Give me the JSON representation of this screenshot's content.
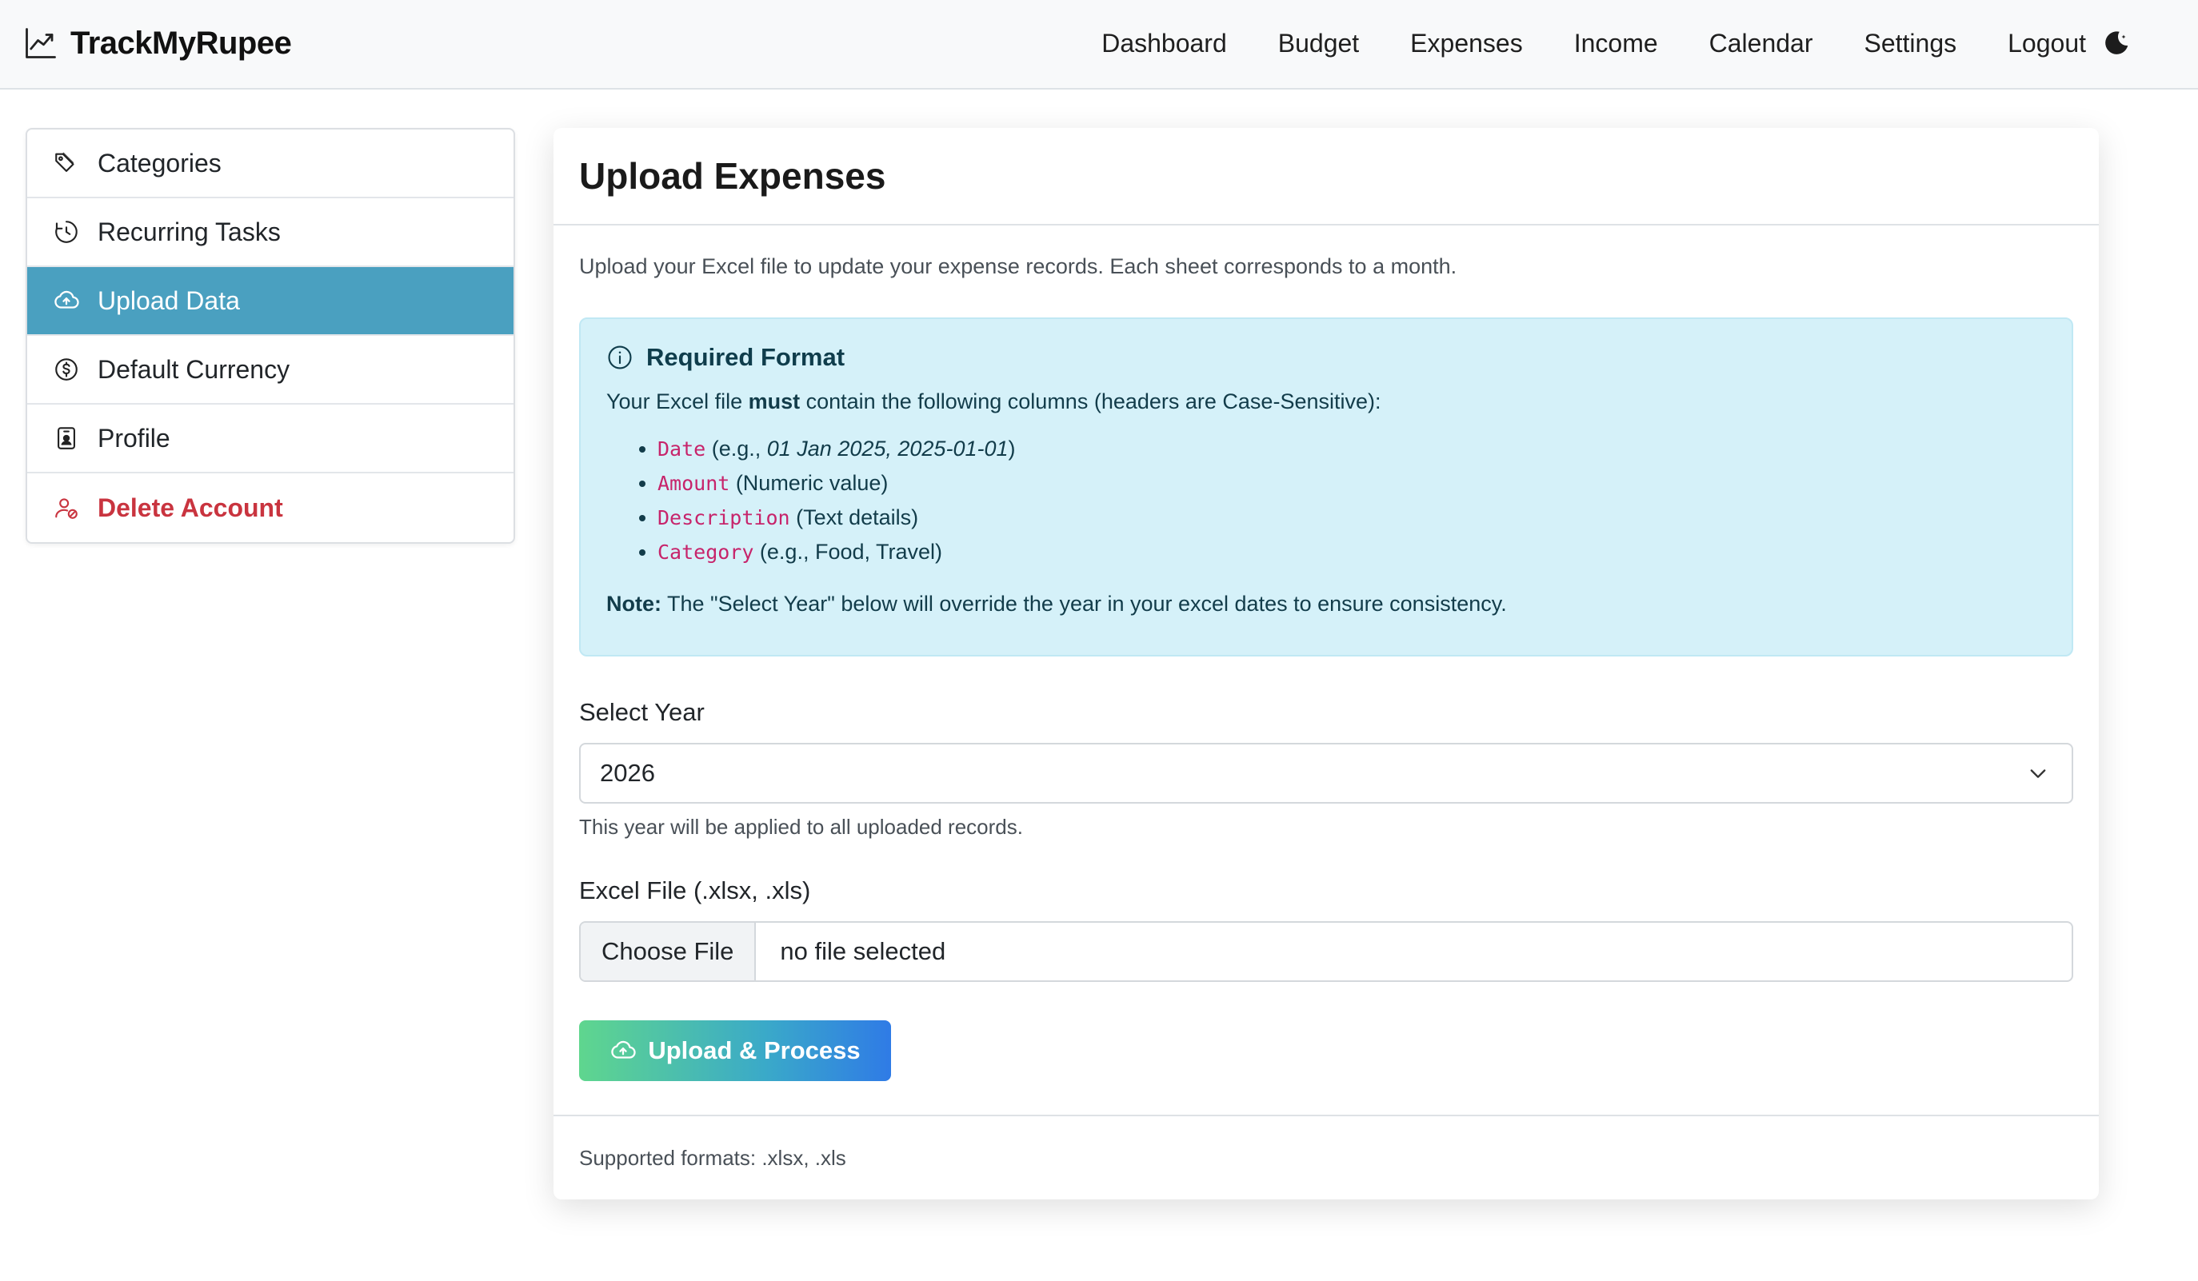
{
  "brand": {
    "name": "TrackMyRupee",
    "icon": "trend-chart-icon"
  },
  "nav": {
    "links": [
      "Dashboard",
      "Budget",
      "Expenses",
      "Income",
      "Calendar",
      "Settings",
      "Logout"
    ],
    "theme_icon": "moon-icon"
  },
  "sidebar": {
    "items": [
      {
        "label": "Categories",
        "icon": "tag-icon",
        "state": "normal"
      },
      {
        "label": "Recurring Tasks",
        "icon": "clock-icon",
        "state": "normal"
      },
      {
        "label": "Upload Data",
        "icon": "cloud-upload-icon",
        "state": "active"
      },
      {
        "label": "Default Currency",
        "icon": "currency-icon",
        "state": "normal"
      },
      {
        "label": "Profile",
        "icon": "person-badge-icon",
        "state": "normal"
      },
      {
        "label": "Delete Account",
        "icon": "person-remove-icon",
        "state": "danger"
      }
    ]
  },
  "main": {
    "title": "Upload Expenses",
    "intro": "Upload your Excel file to update your expense records. Each sheet corresponds to a month.",
    "alert": {
      "title": "Required Format",
      "text_before": "Your Excel file ",
      "text_bold": "must",
      "text_after": " contain the following columns (headers are Case-Sensitive):",
      "columns": [
        {
          "name": "Date",
          "desc_prefix": " (e.g., ",
          "desc_italic": "01 Jan 2025, 2025-01-01",
          "desc_suffix": ")"
        },
        {
          "name": "Amount",
          "desc_prefix": " (Numeric value)",
          "desc_italic": "",
          "desc_suffix": ""
        },
        {
          "name": "Description",
          "desc_prefix": " (Text details)",
          "desc_italic": "",
          "desc_suffix": ""
        },
        {
          "name": "Category",
          "desc_prefix": " (e.g., Food, Travel)",
          "desc_italic": "",
          "desc_suffix": ""
        }
      ],
      "note_label": "Note:",
      "note_text": " The \"Select Year\" below will override the year in your excel dates to ensure consistency."
    },
    "year": {
      "label": "Select Year",
      "value": "2026",
      "help": "This year will be applied to all uploaded records."
    },
    "file": {
      "label": "Excel File (.xlsx, .xls)",
      "button": "Choose File",
      "status": "no file selected"
    },
    "submit_label": "Upload & Process",
    "footer": "Supported formats: .xlsx, .xls"
  },
  "colors": {
    "active_sidebar": "#4aa0c0",
    "danger": "#c9343f",
    "alert_bg": "#d5f1f9",
    "code": "#c7246b"
  }
}
